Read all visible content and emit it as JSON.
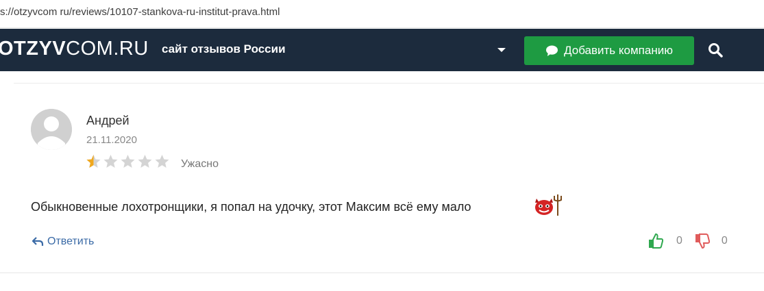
{
  "browser": {
    "url": "s://otzyvcom ru/reviews/10107-stankova-ru-institut-prava.html"
  },
  "header": {
    "logo_bold": "OTZYV",
    "logo_rest": "COM.RU",
    "tagline": "сайт отзывов России",
    "add_button_label": "Добавить компанию",
    "icons": [
      "chevron-down-icon",
      "chat-bubble-icon",
      "search-icon"
    ],
    "colors": {
      "header_bg": "#1c2b3d",
      "add_button": "#1e9b42"
    }
  },
  "review": {
    "author": "Андрей",
    "date": "21.11.2020",
    "rating": 1,
    "rating_max": 5,
    "rating_label": "Ужасно",
    "text": "Обыкновенные лохотронщики, я попал на удочку, этот Максим всё ему мало",
    "emoji": "devil-emoji-icon",
    "reply_label": "Ответить",
    "likes": "0",
    "dislikes": "0",
    "colors": {
      "star_active": "#f0a81e",
      "star_inactive": "#d4d4d4",
      "like": "#2fa84f",
      "dislike": "#e05b5b",
      "reply": "#3a6aa6"
    }
  }
}
